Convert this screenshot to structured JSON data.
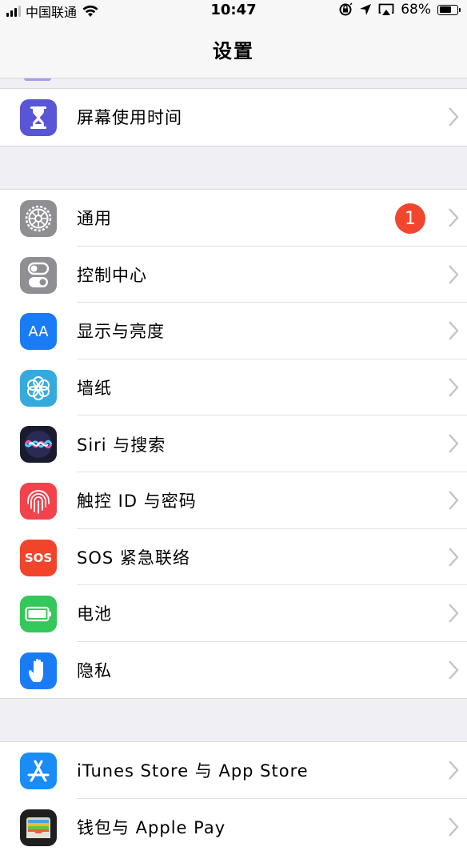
{
  "status_bar": {
    "carrier": "中国联通",
    "time": "10:47",
    "battery": "68%",
    "battery_level": 0.68,
    "icons": [
      "signal-icon",
      "wifi-icon",
      "orientation-lock-icon",
      "location-icon",
      "airplay-icon",
      "battery-icon"
    ]
  },
  "nav": {
    "title": "设置"
  },
  "groups": [
    {
      "items": [
        {
          "label": "屏幕使用时间",
          "icon": "hourglass-icon",
          "color": "#5856d6"
        }
      ]
    },
    {
      "items": [
        {
          "label": "通用",
          "icon": "gear-icon",
          "color": "#8e8e93",
          "badge": "1"
        },
        {
          "label": "控制中心",
          "icon": "toggle-icon",
          "color": "#8e8e93"
        },
        {
          "label": "显示与亮度",
          "icon": "text-size-icon",
          "color": "#1a7cf5",
          "icon_text": "AA"
        },
        {
          "label": "墙纸",
          "icon": "wallpaper-flower-icon",
          "color": "#35aadc"
        },
        {
          "label": "Siri 与搜索",
          "icon": "siri-icon",
          "color": "#1b1b2e"
        },
        {
          "label": "触控 ID 与密码",
          "icon": "fingerprint-icon",
          "color": "#f2424b"
        },
        {
          "label": "SOS 紧急联络",
          "icon": "sos-icon",
          "color": "#f2442b",
          "icon_text": "SOS"
        },
        {
          "label": "电池",
          "icon": "battery-icon",
          "color": "#34c759"
        },
        {
          "label": "隐私",
          "icon": "hand-icon",
          "color": "#1a7cf5"
        }
      ]
    },
    {
      "items": [
        {
          "label": "iTunes Store 与 App Store",
          "icon": "app-store-icon",
          "color": "#1a8cf5"
        },
        {
          "label": "钱包与 Apple Pay",
          "icon": "wallet-icon",
          "color": "#1f1f1f"
        }
      ]
    }
  ]
}
